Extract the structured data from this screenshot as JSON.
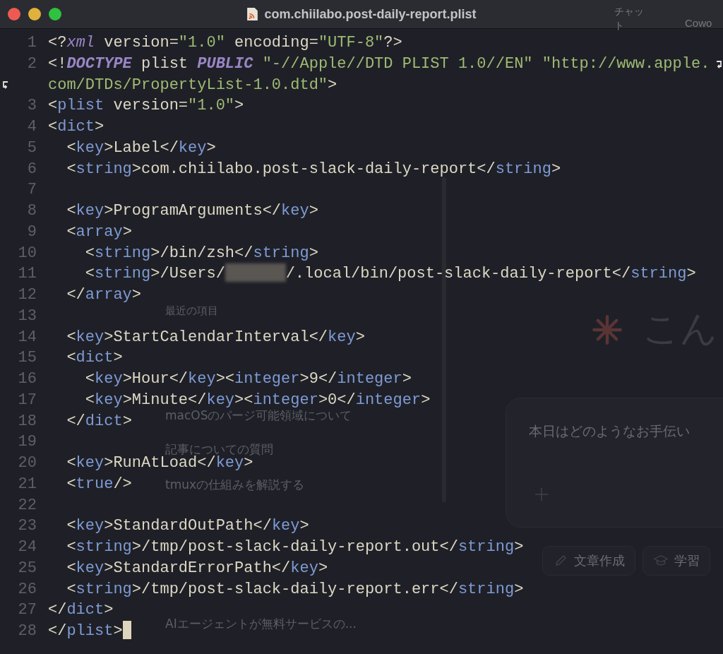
{
  "window": {
    "title": "com.chiilabo.post-daily-report.plist"
  },
  "editor": {
    "lines": [
      {
        "number": "1",
        "cursor": false,
        "tokens": [
          {
            "kind": "punct",
            "text": "<?"
          },
          {
            "kind": "italic",
            "text": "xml"
          },
          {
            "kind": "plain",
            "text": " version="
          },
          {
            "kind": "string",
            "text": "\"1.0\""
          },
          {
            "kind": "plain",
            "text": " encoding="
          },
          {
            "kind": "string",
            "text": "\"UTF-8\""
          },
          {
            "kind": "punct",
            "text": "?>"
          }
        ]
      },
      {
        "number": "2",
        "cursor": false,
        "tokens": [
          {
            "kind": "punct",
            "text": "<!"
          },
          {
            "kind": "keyword",
            "text": "DOCTYPE"
          },
          {
            "kind": "plain",
            "text": " plist "
          },
          {
            "kind": "keyword",
            "text": "PUBLIC"
          },
          {
            "kind": "string",
            "text": " \"-//Apple//DTD PLIST 1.0//EN\" \"http://www.apple.com/DTDs/PropertyList-1.0.dtd\""
          },
          {
            "kind": "punct",
            "text": ">"
          }
        ]
      },
      {
        "number": "3",
        "cursor": false,
        "tokens": [
          {
            "kind": "punct",
            "text": "<"
          },
          {
            "kind": "tag",
            "text": "plist"
          },
          {
            "kind": "plain",
            "text": " version="
          },
          {
            "kind": "string",
            "text": "\"1.0\""
          },
          {
            "kind": "punct",
            "text": ">"
          }
        ]
      },
      {
        "number": "4",
        "cursor": false,
        "tokens": [
          {
            "kind": "punct",
            "text": "<"
          },
          {
            "kind": "tag",
            "text": "dict"
          },
          {
            "kind": "punct",
            "text": ">"
          }
        ]
      },
      {
        "number": "5",
        "cursor": false,
        "tokens": [
          {
            "kind": "punct",
            "text": "  <"
          },
          {
            "kind": "tag",
            "text": "key"
          },
          {
            "kind": "punct",
            "text": ">"
          },
          {
            "kind": "plain",
            "text": "Label"
          },
          {
            "kind": "punct",
            "text": "</"
          },
          {
            "kind": "tag",
            "text": "key"
          },
          {
            "kind": "punct",
            "text": ">"
          }
        ]
      },
      {
        "number": "6",
        "cursor": false,
        "tokens": [
          {
            "kind": "punct",
            "text": "  <"
          },
          {
            "kind": "tag",
            "text": "string"
          },
          {
            "kind": "punct",
            "text": ">"
          },
          {
            "kind": "plain",
            "text": "com.chiilabo.post-slack-daily-report"
          },
          {
            "kind": "punct",
            "text": "</"
          },
          {
            "kind": "tag",
            "text": "string"
          },
          {
            "kind": "punct",
            "text": ">"
          }
        ]
      },
      {
        "number": "7",
        "cursor": false
      },
      {
        "number": "8",
        "cursor": false,
        "tokens": [
          {
            "kind": "punct",
            "text": "  <"
          },
          {
            "kind": "tag",
            "text": "key"
          },
          {
            "kind": "punct",
            "text": ">"
          },
          {
            "kind": "plain",
            "text": "ProgramArguments"
          },
          {
            "kind": "punct",
            "text": "</"
          },
          {
            "kind": "tag",
            "text": "key"
          },
          {
            "kind": "punct",
            "text": ">"
          }
        ]
      },
      {
        "number": "9",
        "cursor": false,
        "tokens": [
          {
            "kind": "punct",
            "text": "  <"
          },
          {
            "kind": "tag",
            "text": "array"
          },
          {
            "kind": "punct",
            "text": ">"
          }
        ]
      },
      {
        "number": "10",
        "cursor": false,
        "tokens": [
          {
            "kind": "punct",
            "text": "    <"
          },
          {
            "kind": "tag",
            "text": "string"
          },
          {
            "kind": "punct",
            "text": ">"
          },
          {
            "kind": "plain",
            "text": "/bin/zsh"
          },
          {
            "kind": "punct",
            "text": "</"
          },
          {
            "kind": "tag",
            "text": "string"
          },
          {
            "kind": "punct",
            "text": ">"
          }
        ]
      },
      {
        "number": "11",
        "cursor": false,
        "tokens": [
          {
            "kind": "punct",
            "text": "    <"
          },
          {
            "kind": "tag",
            "text": "string"
          },
          {
            "kind": "punct",
            "text": ">"
          },
          {
            "kind": "plain",
            "text": "/Users/"
          },
          {
            "kind": "redacted"
          },
          {
            "kind": "plain",
            "text": "/.local/bin/post-slack-daily-report"
          },
          {
            "kind": "punct",
            "text": "</"
          },
          {
            "kind": "tag",
            "text": "string"
          },
          {
            "kind": "punct",
            "text": ">"
          }
        ]
      },
      {
        "number": "12",
        "cursor": false,
        "tokens": [
          {
            "kind": "punct",
            "text": "  </"
          },
          {
            "kind": "tag",
            "text": "array"
          },
          {
            "kind": "punct",
            "text": ">"
          }
        ]
      },
      {
        "number": "13",
        "cursor": false
      },
      {
        "number": "14",
        "cursor": false,
        "tokens": [
          {
            "kind": "punct",
            "text": "  <"
          },
          {
            "kind": "tag",
            "text": "key"
          },
          {
            "kind": "punct",
            "text": ">"
          },
          {
            "kind": "plain",
            "text": "StartCalendarInterval"
          },
          {
            "kind": "punct",
            "text": "</"
          },
          {
            "kind": "tag",
            "text": "key"
          },
          {
            "kind": "punct",
            "text": ">"
          }
        ]
      },
      {
        "number": "15",
        "cursor": false,
        "tokens": [
          {
            "kind": "punct",
            "text": "  <"
          },
          {
            "kind": "tag",
            "text": "dict"
          },
          {
            "kind": "punct",
            "text": ">"
          }
        ]
      },
      {
        "number": "16",
        "cursor": false,
        "tokens": [
          {
            "kind": "punct",
            "text": "    <"
          },
          {
            "kind": "tag",
            "text": "key"
          },
          {
            "kind": "punct",
            "text": ">"
          },
          {
            "kind": "plain",
            "text": "Hour"
          },
          {
            "kind": "punct",
            "text": "</"
          },
          {
            "kind": "tag",
            "text": "key"
          },
          {
            "kind": "punct",
            "text": "><"
          },
          {
            "kind": "tag",
            "text": "integer"
          },
          {
            "kind": "punct",
            "text": ">"
          },
          {
            "kind": "plain",
            "text": "9"
          },
          {
            "kind": "punct",
            "text": "</"
          },
          {
            "kind": "tag",
            "text": "integer"
          },
          {
            "kind": "punct",
            "text": ">"
          }
        ]
      },
      {
        "number": "17",
        "cursor": false,
        "tokens": [
          {
            "kind": "punct",
            "text": "    <"
          },
          {
            "kind": "tag",
            "text": "key"
          },
          {
            "kind": "punct",
            "text": ">"
          },
          {
            "kind": "plain",
            "text": "Minute"
          },
          {
            "kind": "punct",
            "text": "</"
          },
          {
            "kind": "tag",
            "text": "key"
          },
          {
            "kind": "punct",
            "text": "><"
          },
          {
            "kind": "tag",
            "text": "integer"
          },
          {
            "kind": "punct",
            "text": ">"
          },
          {
            "kind": "plain",
            "text": "0"
          },
          {
            "kind": "punct",
            "text": "</"
          },
          {
            "kind": "tag",
            "text": "integer"
          },
          {
            "kind": "punct",
            "text": ">"
          }
        ]
      },
      {
        "number": "18",
        "cursor": false,
        "tokens": [
          {
            "kind": "punct",
            "text": "  </"
          },
          {
            "kind": "tag",
            "text": "dict"
          },
          {
            "kind": "punct",
            "text": ">"
          }
        ]
      },
      {
        "number": "19",
        "cursor": false
      },
      {
        "number": "20",
        "cursor": false,
        "tokens": [
          {
            "kind": "punct",
            "text": "  <"
          },
          {
            "kind": "tag",
            "text": "key"
          },
          {
            "kind": "punct",
            "text": ">"
          },
          {
            "kind": "plain",
            "text": "RunAtLoad"
          },
          {
            "kind": "punct",
            "text": "</"
          },
          {
            "kind": "tag",
            "text": "key"
          },
          {
            "kind": "punct",
            "text": ">"
          }
        ]
      },
      {
        "number": "21",
        "cursor": false,
        "tokens": [
          {
            "kind": "punct",
            "text": "  <"
          },
          {
            "kind": "tag",
            "text": "true"
          },
          {
            "kind": "punct",
            "text": "/>"
          }
        ]
      },
      {
        "number": "22",
        "cursor": false
      },
      {
        "number": "23",
        "cursor": false,
        "tokens": [
          {
            "kind": "punct",
            "text": "  <"
          },
          {
            "kind": "tag",
            "text": "key"
          },
          {
            "kind": "punct",
            "text": ">"
          },
          {
            "kind": "plain",
            "text": "StandardOutPath"
          },
          {
            "kind": "punct",
            "text": "</"
          },
          {
            "kind": "tag",
            "text": "key"
          },
          {
            "kind": "punct",
            "text": ">"
          }
        ]
      },
      {
        "number": "24",
        "cursor": false,
        "tokens": [
          {
            "kind": "punct",
            "text": "  <"
          },
          {
            "kind": "tag",
            "text": "string"
          },
          {
            "kind": "punct",
            "text": ">"
          },
          {
            "kind": "plain",
            "text": "/tmp/post-slack-daily-report.out"
          },
          {
            "kind": "punct",
            "text": "</"
          },
          {
            "kind": "tag",
            "text": "string"
          },
          {
            "kind": "punct",
            "text": ">"
          }
        ]
      },
      {
        "number": "25",
        "cursor": false,
        "tokens": [
          {
            "kind": "punct",
            "text": "  <"
          },
          {
            "kind": "tag",
            "text": "key"
          },
          {
            "kind": "punct",
            "text": ">"
          },
          {
            "kind": "plain",
            "text": "StandardErrorPath"
          },
          {
            "kind": "punct",
            "text": "</"
          },
          {
            "kind": "tag",
            "text": "key"
          },
          {
            "kind": "punct",
            "text": ">"
          }
        ]
      },
      {
        "number": "26",
        "cursor": false,
        "tokens": [
          {
            "kind": "punct",
            "text": "  <"
          },
          {
            "kind": "tag",
            "text": "string"
          },
          {
            "kind": "punct",
            "text": ">"
          },
          {
            "kind": "plain",
            "text": "/tmp/post-slack-daily-report.err"
          },
          {
            "kind": "punct",
            "text": "</"
          },
          {
            "kind": "tag",
            "text": "string"
          },
          {
            "kind": "punct",
            "text": ">"
          }
        ]
      },
      {
        "number": "27",
        "cursor": false,
        "tokens": [
          {
            "kind": "punct",
            "text": "</"
          },
          {
            "kind": "tag",
            "text": "dict"
          },
          {
            "kind": "punct",
            "text": ">"
          }
        ]
      },
      {
        "number": "28",
        "cursor": true,
        "tokens": [
          {
            "kind": "punct",
            "text": "</"
          },
          {
            "kind": "tag",
            "text": "plist"
          },
          {
            "kind": "punct",
            "text": ">"
          }
        ]
      }
    ]
  },
  "background_app": {
    "tab": "チャット",
    "tab_2": "Cowo",
    "sidebar_heading": "最近の項目",
    "recent_items": [
      "macOSのパージ可能領域について",
      "記事についての質問",
      "tmuxの仕組みを解説する",
      "AIエージェントが無料サービスの..."
    ],
    "greeting": "こん",
    "prompt_placeholder": "本日はどのようなお手伝い",
    "chips": [
      "文章作成",
      "学習"
    ]
  }
}
